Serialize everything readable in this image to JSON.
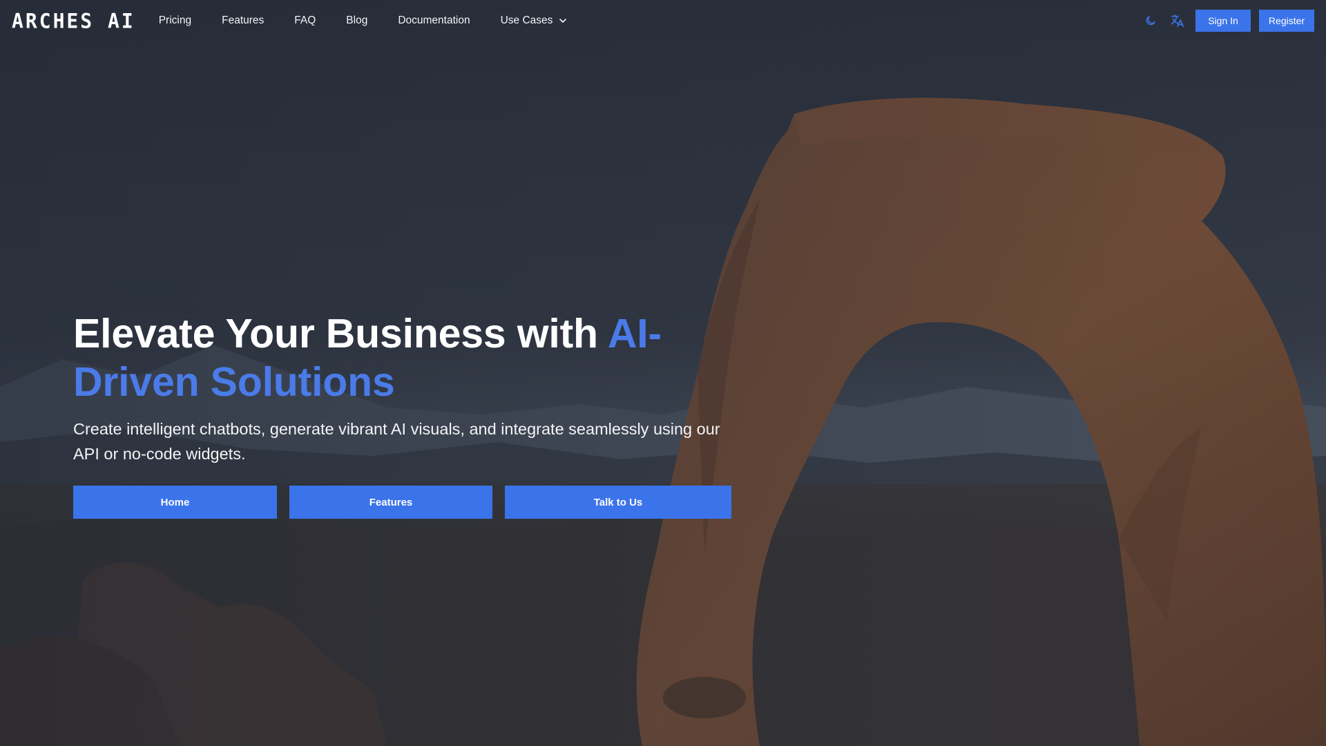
{
  "brand": {
    "logo_text": "ARCHES AI"
  },
  "nav": {
    "links": [
      {
        "label": "Pricing"
      },
      {
        "label": "Features"
      },
      {
        "label": "FAQ"
      },
      {
        "label": "Blog"
      },
      {
        "label": "Documentation"
      },
      {
        "label": "Use Cases",
        "has_dropdown": true
      }
    ],
    "icons": [
      "moon-icon",
      "translate-icon",
      "chevron-down-icon"
    ],
    "sign_in_label": "Sign In",
    "register_label": "Register"
  },
  "hero": {
    "title_plain": "Elevate Your Business with ",
    "title_accent": "AI-Driven Solutions",
    "subtitle": "Create intelligent chatbots, generate vibrant AI visuals, and integrate seamlessly using our API or no-code widgets.",
    "buttons": [
      {
        "label": "Home"
      },
      {
        "label": "Features"
      },
      {
        "label": "Talk to Us"
      }
    ]
  },
  "colors": {
    "accent": "#4a7be8",
    "button": "#3b74ea",
    "background": "#2a303b",
    "rock": "#8a5a3b"
  }
}
